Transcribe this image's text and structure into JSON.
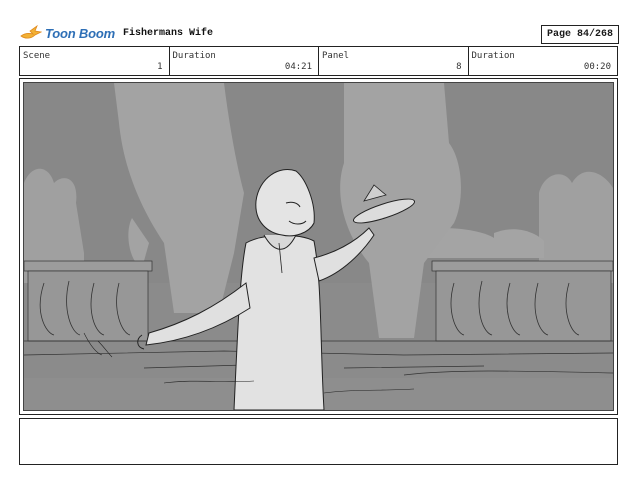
{
  "header": {
    "brand": "Toon Boom",
    "project_title": "Fishermans Wife",
    "page_label": "Page",
    "page_value": "84/268"
  },
  "info": {
    "scene_label": "Scene",
    "scene_value": "1",
    "duration1_label": "Duration",
    "duration1_value": "04:21",
    "panel_label": "Panel",
    "panel_value": "8",
    "duration2_label": "Duration",
    "duration2_value": "00:20"
  },
  "icons": [
    "toon-boom-logo-icon"
  ],
  "colors": {
    "brand": "#2e6fb6",
    "logo_accent": "#f2b134"
  }
}
